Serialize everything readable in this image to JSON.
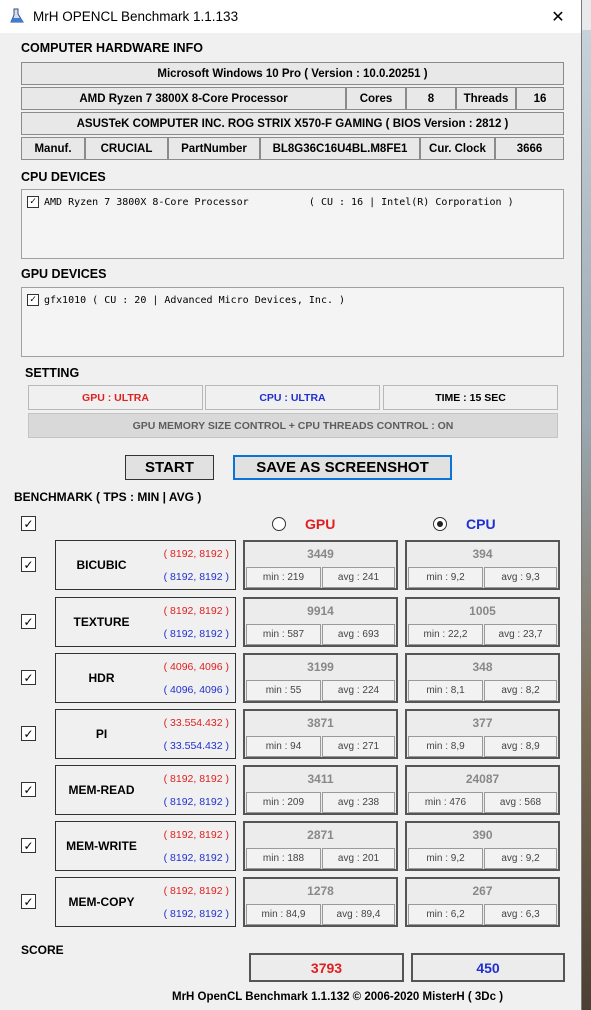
{
  "window": {
    "title": "MrH OPENCL Benchmark 1.1.133",
    "close": "✕"
  },
  "hw": {
    "section": "COMPUTER HARDWARE INFO",
    "os": "Microsoft Windows 10 Pro ( Version : 10.0.20251 )",
    "cpu_name": "AMD Ryzen 7 3800X 8-Core Processor",
    "cores_label": "Cores",
    "cores": "8",
    "threads_label": "Threads",
    "threads": "16",
    "board": "ASUSTeK COMPUTER INC. ROG STRIX X570-F GAMING ( BIOS Version : 2812 )",
    "manuf_label": "Manuf.",
    "manuf": "CRUCIAL",
    "part_label": "PartNumber",
    "part": "BL8G36C16U4BL.M8FE1",
    "clock_label": "Cur. Clock",
    "clock": "3666"
  },
  "cpu_devices": {
    "section": "CPU DEVICES",
    "item": "AMD Ryzen 7 3800X 8-Core Processor          ( CU : 16 | Intel(R) Corporation )"
  },
  "gpu_devices": {
    "section": "GPU DEVICES",
    "item": "gfx1010 ( CU : 20 | Advanced Micro Devices, Inc. )"
  },
  "setting": {
    "section": "SETTING",
    "gpu": "GPU : ULTRA",
    "cpu": "CPU : ULTRA",
    "time": "TIME : 15 SEC",
    "memctl": "GPU MEMORY SIZE CONTROL + CPU THREADS CONTROL : ON"
  },
  "buttons": {
    "start": "START",
    "save": "SAVE AS SCREENSHOT"
  },
  "bench": {
    "section": "BENCHMARK ( TPS : MIN | AVG )",
    "gpu_label": "GPU",
    "cpu_label": "CPU",
    "selected": "CPU",
    "colors": {
      "gpu": "#e02020",
      "cpu": "#2030d0"
    },
    "rows": [
      {
        "name": "BICUBIC",
        "gsize": "( 8192, 8192 )",
        "csize": "( 8192, 8192 )",
        "gpu": {
          "score": "3449",
          "min": "min : 219",
          "avg": "avg : 241"
        },
        "cpu": {
          "score": "394",
          "min": "min : 9,2",
          "avg": "avg : 9,3"
        }
      },
      {
        "name": "TEXTURE",
        "gsize": "( 8192, 8192 )",
        "csize": "( 8192, 8192 )",
        "gpu": {
          "score": "9914",
          "min": "min : 587",
          "avg": "avg : 693"
        },
        "cpu": {
          "score": "1005",
          "min": "min : 22,2",
          "avg": "avg : 23,7"
        }
      },
      {
        "name": "HDR",
        "gsize": "( 4096, 4096 )",
        "csize": "( 4096, 4096 )",
        "gpu": {
          "score": "3199",
          "min": "min : 55",
          "avg": "avg : 224"
        },
        "cpu": {
          "score": "348",
          "min": "min : 8,1",
          "avg": "avg : 8,2"
        }
      },
      {
        "name": "PI",
        "gsize": "( 33.554.432 )",
        "csize": "( 33.554.432 )",
        "gpu": {
          "score": "3871",
          "min": "min : 94",
          "avg": "avg : 271"
        },
        "cpu": {
          "score": "377",
          "min": "min : 8,9",
          "avg": "avg : 8,9"
        }
      },
      {
        "name": "MEM-READ",
        "gsize": "( 8192, 8192 )",
        "csize": "( 8192, 8192 )",
        "gpu": {
          "score": "3411",
          "min": "min : 209",
          "avg": "avg : 238"
        },
        "cpu": {
          "score": "24087",
          "min": "min : 476",
          "avg": "avg : 568"
        }
      },
      {
        "name": "MEM-WRITE",
        "gsize": "( 8192, 8192 )",
        "csize": "( 8192, 8192 )",
        "gpu": {
          "score": "2871",
          "min": "min : 188",
          "avg": "avg : 201"
        },
        "cpu": {
          "score": "390",
          "min": "min : 9,2",
          "avg": "avg : 9,2"
        }
      },
      {
        "name": "MEM-COPY",
        "gsize": "( 8192, 8192 )",
        "csize": "( 8192, 8192 )",
        "gpu": {
          "score": "1278",
          "min": "min : 84,9",
          "avg": "avg : 89,4"
        },
        "cpu": {
          "score": "267",
          "min": "min : 6,2",
          "avg": "avg : 6,3"
        }
      }
    ]
  },
  "score": {
    "section": "SCORE",
    "gpu": "3793",
    "cpu": "450"
  },
  "footer": "MrH OpenCL Benchmark 1.1.132 © 2006-2020 MisterH ( 3Dc )"
}
